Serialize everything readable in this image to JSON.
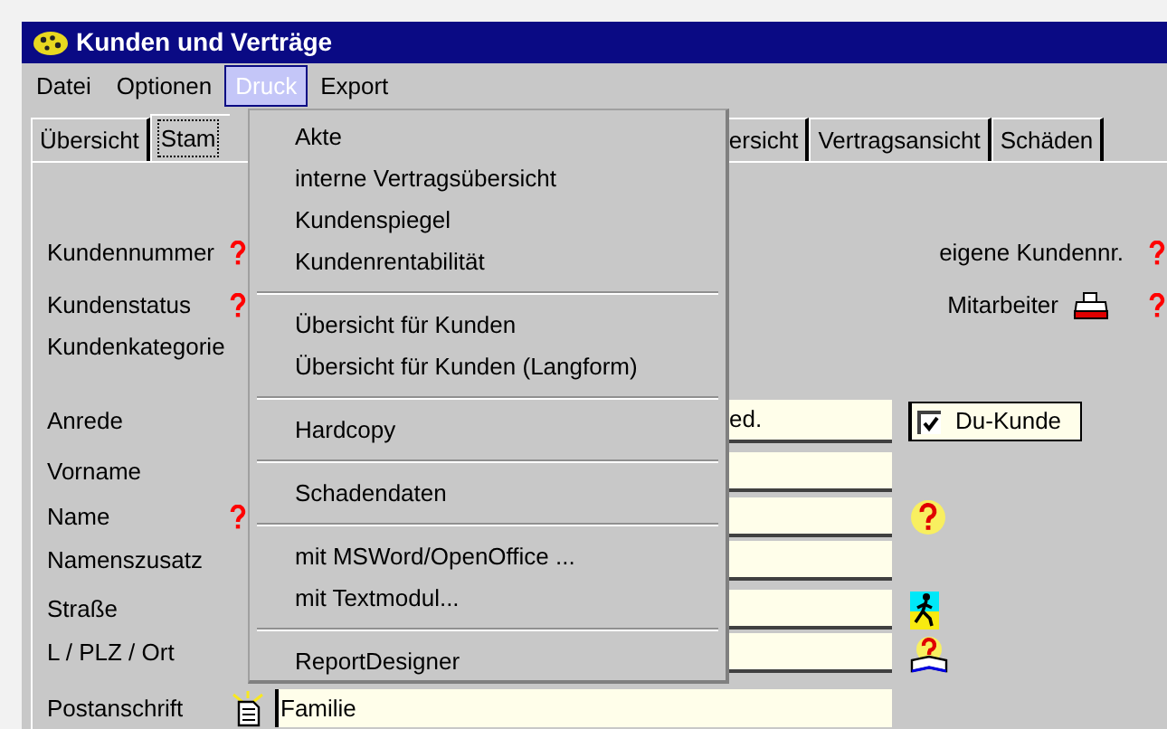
{
  "window": {
    "title": "Kunden und Verträge"
  },
  "menu_bar": [
    {
      "label": "Datei",
      "selected": false
    },
    {
      "label": "Optionen",
      "selected": false
    },
    {
      "label": "Druck",
      "selected": true
    },
    {
      "label": "Export",
      "selected": false
    }
  ],
  "tabs": [
    {
      "label": "Übersicht",
      "selected": false
    },
    {
      "label": "Stam",
      "selected": true
    },
    {
      "label": "ersicht",
      "selected": false
    },
    {
      "label": "Vertragsansicht",
      "selected": false
    },
    {
      "label": "Schäden",
      "selected": false
    }
  ],
  "dropdown_menu": {
    "groups": [
      [
        "Akte",
        "interne Vertragsübersicht",
        "Kundenspiegel",
        "Kundenrentabilität"
      ],
      [
        "Übersicht für Kunden",
        "Übersicht für Kunden (Langform)"
      ],
      [
        "Hardcopy"
      ],
      [
        "Schadendaten"
      ],
      [
        "mit MSWord/OpenOffice ...",
        "mit Textmodul..."
      ],
      [
        "ReportDesigner"
      ]
    ]
  },
  "form": {
    "rows": [
      {
        "kind": "label",
        "label": "Kundennummer",
        "required": true
      },
      {
        "kind": "label",
        "label": "Kundenstatus",
        "required": true
      },
      {
        "kind": "label",
        "label": "Kundenkategorie",
        "required": false
      },
      {
        "kind": "field",
        "label": "Anrede",
        "required": false,
        "value": "ed."
      },
      {
        "kind": "field",
        "label": "Vorname",
        "required": false
      },
      {
        "kind": "field_help",
        "label": "Name",
        "required": true
      },
      {
        "kind": "field",
        "label": "Namenszusatz",
        "required": false
      },
      {
        "kind": "field_walk",
        "label": "Straße",
        "required": false
      },
      {
        "kind": "field_book",
        "label": "L / PLZ / Ort",
        "required": false
      },
      {
        "kind": "address",
        "label": "Postanschrift",
        "required": false,
        "value": "Familie"
      }
    ],
    "customer_own_number": {
      "label": "eigene Kundennr.",
      "required": true
    },
    "employee": {
      "label": "Mitarbeiter",
      "required": true
    },
    "du_kunde": {
      "label": "Du-Kunde",
      "checked": true
    }
  }
}
